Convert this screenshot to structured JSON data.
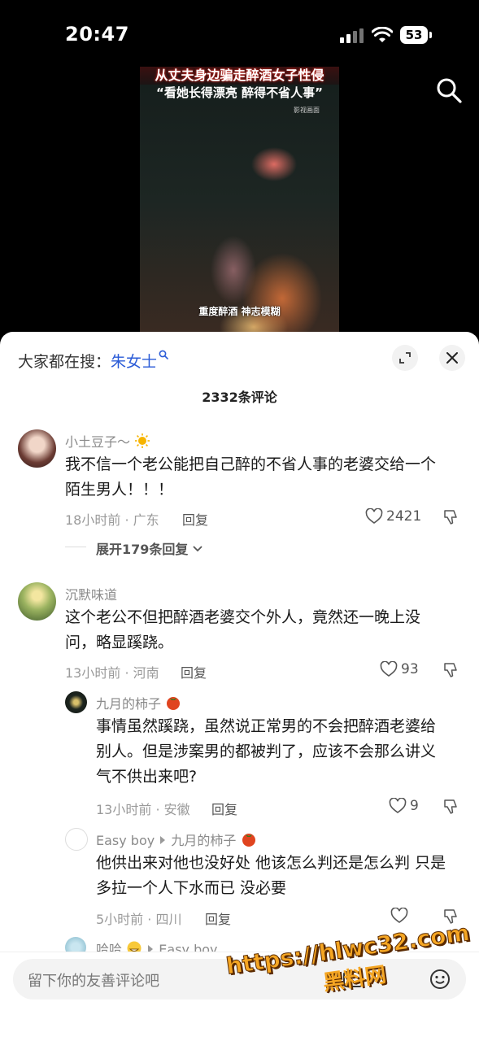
{
  "status_bar": {
    "time": "20:47",
    "battery": "53"
  },
  "video": {
    "title_line1": "从丈夫身边骗走醉酒女子性侵",
    "title_line2": "“看她长得漂亮 醉得不省人事”",
    "source": "影视画面",
    "caption": "重度醉酒 神志模糊"
  },
  "sheet": {
    "trend_prefix": "大家都在搜：",
    "trend_keyword": "朱女士",
    "comment_count": "2332条评论"
  },
  "comments": [
    {
      "user": "小土豆子～",
      "text_line1": "我不信一个老公能把自己醉的不省人事的老婆交给一个",
      "text_line2": "陌生男人！！！",
      "meta": "18小时前 · 广东",
      "reply": "回复",
      "likes": "2421",
      "expand": "展开179条回复"
    },
    {
      "user": "沉默味道",
      "text_line1": "这个老公不但把醉酒老婆交个外人，竟然还一晚上没",
      "text_line2": "问，略显蹊跷。",
      "meta": "13小时前 · 河南",
      "reply": "回复",
      "likes": "93"
    }
  ],
  "replies": [
    {
      "user": "九月的柿子",
      "text_line1": "事情虽然蹊跷，虽然说正常男的不会把醉酒老婆给",
      "text_line2": "别人。但是涉案男的都被判了，应该不会那么讲义",
      "text_line3": "气不供出来吧?",
      "meta": "13小时前 · 安徽",
      "reply": "回复",
      "likes": "9"
    },
    {
      "user": "Easy boy",
      "reply_to": "九月的柿子",
      "text_line1": "他供出来对他也没好处 他该怎么判还是怎么判  只是",
      "text_line2": "多拉一个人下水而已 没必要",
      "meta": "5小时前 · 四川",
      "reply": "回复"
    },
    {
      "user": "哈哈",
      "reply_to": "Easy boy"
    }
  ],
  "input": {
    "placeholder": "留下你的友善评论吧"
  },
  "watermark": {
    "url": "https://hlwc32.com",
    "name": "黑料网"
  },
  "colors": {
    "link_blue": "#2a5bd7",
    "watermark_orange": "#f5a623"
  }
}
